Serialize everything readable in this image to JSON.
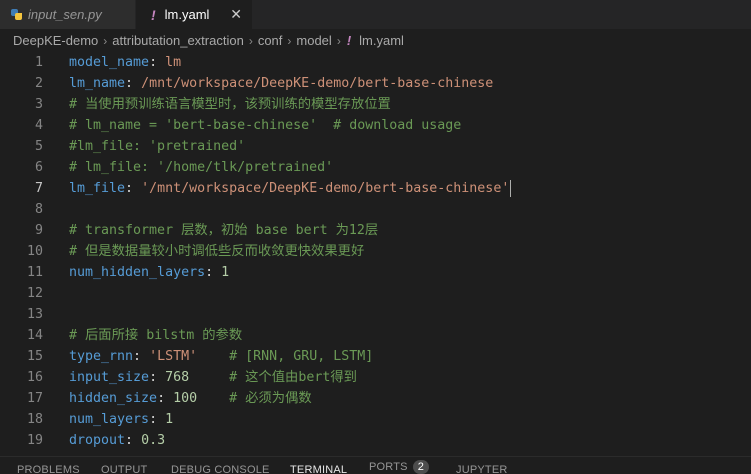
{
  "tabs": [
    {
      "label": "input_sen.py",
      "icon": "python-file-icon",
      "active": false
    },
    {
      "label": "lm.yaml",
      "icon": "yaml-file-icon",
      "active": true,
      "close": "✕"
    }
  ],
  "breadcrumb": {
    "items": [
      "DeepKE-demo",
      "attributation_extraction",
      "conf",
      "model"
    ],
    "file": "lm.yaml",
    "separator": "›",
    "file_icon": "!"
  },
  "editor": {
    "current_line": 7,
    "lines": [
      {
        "num": "1",
        "text": "model_name: lm"
      },
      {
        "num": "2",
        "text": "lm_name: /mnt/workspace/DeepKE-demo/bert-base-chinese"
      },
      {
        "num": "3",
        "text": "# 当使用预训练语言模型时，该预训练的模型存放位置"
      },
      {
        "num": "4",
        "text": "# lm_name = 'bert-base-chinese'  # download usage"
      },
      {
        "num": "5",
        "text": "#lm_file: 'pretrained'"
      },
      {
        "num": "6",
        "text": "# lm_file: '/home/tlk/pretrained'"
      },
      {
        "num": "7",
        "text": "lm_file: '/mnt/workspace/DeepKE-demo/bert-base-chinese'"
      },
      {
        "num": "8",
        "text": ""
      },
      {
        "num": "9",
        "text": "# transformer 层数，初始 base bert 为12层"
      },
      {
        "num": "10",
        "text": "# 但是数据量较小时调低些反而收敛更快效果更好"
      },
      {
        "num": "11",
        "text": "num_hidden_layers: 1"
      },
      {
        "num": "12",
        "text": ""
      },
      {
        "num": "13",
        "text": ""
      },
      {
        "num": "14",
        "text": "# 后面所接 bilstm 的参数"
      },
      {
        "num": "15",
        "text": "type_rnn: 'LSTM'    # [RNN, GRU, LSTM]"
      },
      {
        "num": "16",
        "text": "input_size: 768     # 这个值由bert得到"
      },
      {
        "num": "17",
        "text": "hidden_size: 100    # 必须为偶数"
      },
      {
        "num": "18",
        "text": "num_layers: 1"
      },
      {
        "num": "19",
        "text": "dropout: 0.3"
      }
    ]
  },
  "panel": {
    "tabs": [
      {
        "label": "PROBLEMS",
        "active": false
      },
      {
        "label": "OUTPUT",
        "active": false
      },
      {
        "label": "DEBUG CONSOLE",
        "active": false
      },
      {
        "label": "TERMINAL",
        "active": true
      },
      {
        "label": "PORTS",
        "active": false,
        "badge": "2"
      },
      {
        "label": "JUPYTER",
        "active": false
      }
    ]
  },
  "colors": {
    "background": "#1e1e1e",
    "key": "#569cd6",
    "string": "#ce9178",
    "number": "#b5cea8",
    "comment": "#6a9955",
    "yaml_icon": "#c586c0"
  }
}
